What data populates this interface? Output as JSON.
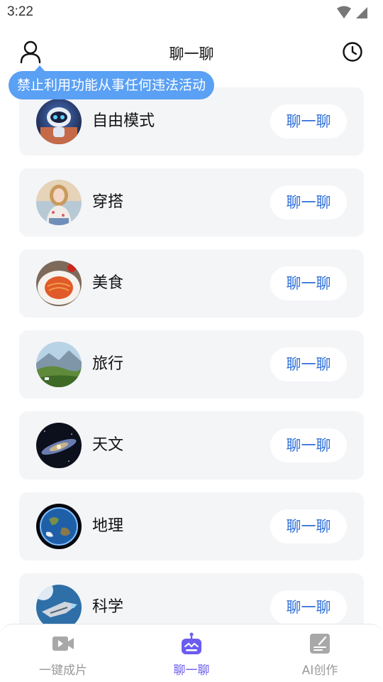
{
  "status": {
    "time": "3:22"
  },
  "header": {
    "title": "聊一聊"
  },
  "tooltip": {
    "text": "禁止利用功能从事任何违法活动"
  },
  "items": [
    {
      "label": "自由模式",
      "button": "聊一聊"
    },
    {
      "label": "穿搭",
      "button": "聊一聊"
    },
    {
      "label": "美食",
      "button": "聊一聊"
    },
    {
      "label": "旅行",
      "button": "聊一聊"
    },
    {
      "label": "天文",
      "button": "聊一聊"
    },
    {
      "label": "地理",
      "button": "聊一聊"
    },
    {
      "label": "科学",
      "button": "聊一聊"
    }
  ],
  "nav": [
    {
      "label": "一键成片",
      "icon": "video-icon",
      "active": false
    },
    {
      "label": "聊一聊",
      "icon": "robot-icon",
      "active": true
    },
    {
      "label": "AI创作",
      "icon": "edit-note-icon",
      "active": false
    }
  ],
  "colors": {
    "accent": "#6b5cf0",
    "tooltip": "#5aa0f4",
    "link": "#2f6fd8",
    "card": "#f4f5f7"
  }
}
